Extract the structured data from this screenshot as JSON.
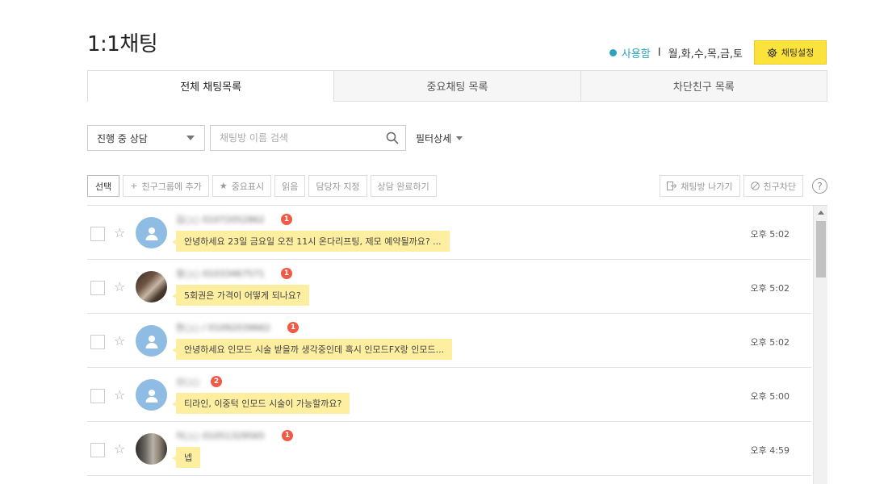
{
  "page": {
    "title": "1:1채팅"
  },
  "status": {
    "text": "사용함",
    "separator": "I",
    "days": "월,화,수,목,금,토",
    "settings_label": "채팅설정",
    "accent": "#2ba3bd"
  },
  "tabs": [
    {
      "label": "전체 채팅목록",
      "active": true
    },
    {
      "label": "중요채팅 목록",
      "active": false
    },
    {
      "label": "차단친구 목록",
      "active": false
    }
  ],
  "filter": {
    "select_value": "진행 중 상담",
    "search_placeholder": "채팅방 이름 검색",
    "detail_label": "필터상세"
  },
  "actions": {
    "select": "선택",
    "add_group": "친구그룹에 추가",
    "important": "중요표시",
    "read": "읽음",
    "assign": "담당자 지정",
    "complete": "상담 완료하기",
    "leave": "채팅방 나가기",
    "block": "친구차단",
    "help": "?"
  },
  "chats": [
    {
      "name": "김○○ 01072052862",
      "unread": "1",
      "message": "안녕하세요 23일 금요일 오전 11시 온다리프팅, 제모 예약될까요? ...",
      "time": "오후 5:02",
      "avatar": "default"
    },
    {
      "name": "정○○ 01033467571",
      "unread": "1",
      "message": "5회권은 가격이 어떻게 되나요?",
      "time": "오후 5:02",
      "avatar": "photo1"
    },
    {
      "name": "한○○ / 01092039662",
      "unread": "1",
      "message": "안녕하세요 인모드 시술 받을까 생각중인데 혹시 인모드FX랑 인모드...",
      "time": "오후 5:02",
      "avatar": "default"
    },
    {
      "name": "신○○",
      "unread": "2",
      "message": "티라인, 이중턱 인모드 시술이 가능할까요?",
      "time": "오후 5:00",
      "avatar": "default"
    },
    {
      "name": "이○○ 01051329565",
      "unread": "1",
      "message": "넵",
      "time": "오후 4:59",
      "avatar": "photo2"
    }
  ]
}
